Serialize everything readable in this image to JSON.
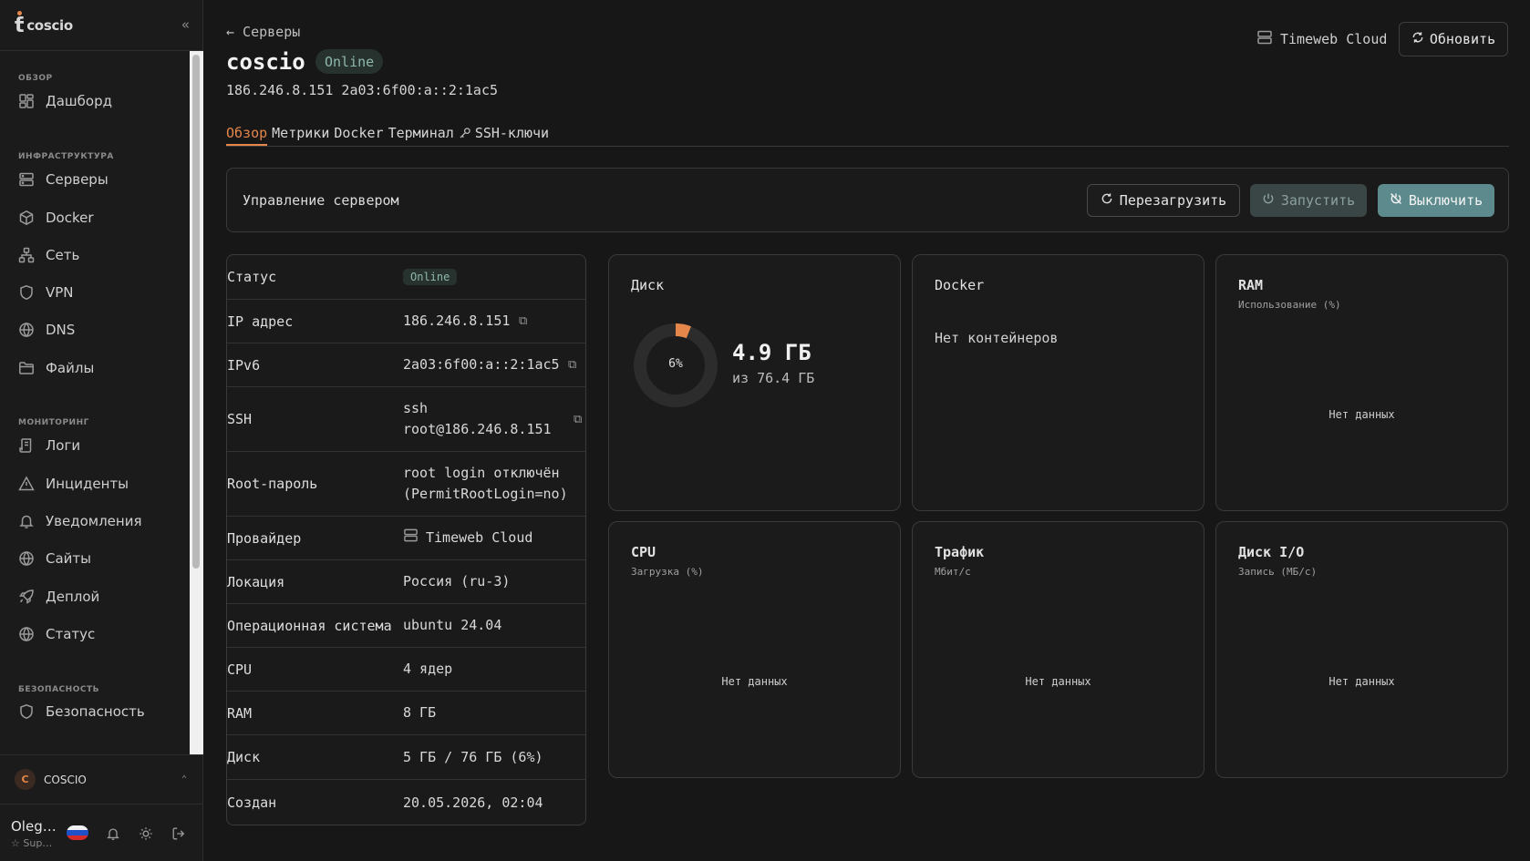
{
  "app": {
    "brand": "coscio"
  },
  "sidebar": {
    "sections": [
      {
        "label": "ОБЗОР"
      },
      {
        "label": "ИНФРАСТРУКТУРА"
      },
      {
        "label": "МОНИТОРИНГ"
      },
      {
        "label": "БЕЗОПАСНОСТЬ"
      }
    ],
    "items": [
      {
        "label": "Дашборд",
        "icon": "dashboard-icon"
      },
      {
        "label": "Серверы",
        "icon": "server-icon"
      },
      {
        "label": "Docker",
        "icon": "box-icon"
      },
      {
        "label": "Сеть",
        "icon": "network-icon"
      },
      {
        "label": "VPN",
        "icon": "shield-icon"
      },
      {
        "label": "DNS",
        "icon": "globe-icon"
      },
      {
        "label": "Файлы",
        "icon": "folder-icon"
      },
      {
        "label": "Логи",
        "icon": "logs-icon"
      },
      {
        "label": "Инциденты",
        "icon": "warning-icon"
      },
      {
        "label": "Уведомления",
        "icon": "bell-icon"
      },
      {
        "label": "Сайты",
        "icon": "globe-icon"
      },
      {
        "label": "Деплой",
        "icon": "rocket-icon"
      },
      {
        "label": "Статус",
        "icon": "globe-icon"
      },
      {
        "label": "Безопасность",
        "icon": "shield-icon"
      }
    ],
    "org": {
      "initial": "C",
      "name": "COSCIO"
    },
    "user": {
      "name": "Oleg…",
      "role": "Sup…"
    }
  },
  "header": {
    "back": "← Серверы",
    "title": "coscio",
    "status": "Online",
    "ips": "186.246.8.151 2a03:6f00:a::2:1ac5",
    "provider": "Timeweb Cloud",
    "refresh": "Обновить"
  },
  "tabs": [
    {
      "label": "Обзор",
      "active": true
    },
    {
      "label": "Метрики",
      "active": false
    },
    {
      "label": "Docker",
      "active": false
    },
    {
      "label": "Терминал",
      "active": false
    },
    {
      "label": "SSH-ключи",
      "active": false
    }
  ],
  "control": {
    "title": "Управление сервером",
    "restart": "Перезагрузить",
    "start": "Запустить",
    "stop": "Выключить"
  },
  "info": [
    {
      "key": "Статус",
      "value": "Online"
    },
    {
      "key": "IP адрес",
      "value": "186.246.8.151"
    },
    {
      "key": "IPv6",
      "value": "2a03:6f00:a::2:1ac5"
    },
    {
      "key": "SSH",
      "value1": "ssh",
      "value2": "root@186.246.8.151"
    },
    {
      "key": "Root-пароль",
      "value1": "root login отключён",
      "value2": "(PermitRootLogin=no)"
    },
    {
      "key": "Провайдер",
      "value": "Timeweb Cloud"
    },
    {
      "key": "Локация",
      "value": "Россия (ru-3)"
    },
    {
      "key": "Операционная система",
      "value": "ubuntu 24.04"
    },
    {
      "key": "CPU",
      "value": "4 ядер"
    },
    {
      "key": "RAM",
      "value": "8 ГБ"
    },
    {
      "key": "Диск",
      "value": "5 ГБ / 76 ГБ (6%)"
    },
    {
      "key": "Создан",
      "value": "20.05.2026, 02:04"
    }
  ],
  "cards": {
    "disk": {
      "title": "Диск",
      "percent_label": "6%",
      "percent": 6,
      "used": "4.9 ГБ",
      "total": "из 76.4 ГБ"
    },
    "docker": {
      "title": "Docker",
      "empty": "Нет контейнеров"
    },
    "ram": {
      "title": "RAM",
      "subtitle": "Использование (%)",
      "empty": "Нет данных"
    },
    "cpu": {
      "title": "CPU",
      "subtitle": "Загрузка (%)",
      "empty": "Нет данных"
    },
    "traffic": {
      "title": "Трафик",
      "subtitle": "Мбит/с",
      "empty": "Нет данных"
    },
    "diskio": {
      "title": "Диск I/O",
      "subtitle": "Запись (МБ/с)",
      "empty": "Нет данных"
    }
  },
  "colors": {
    "accent": "#e5864a",
    "teal": "#5d8b8d",
    "online": "#8fb8ad"
  }
}
